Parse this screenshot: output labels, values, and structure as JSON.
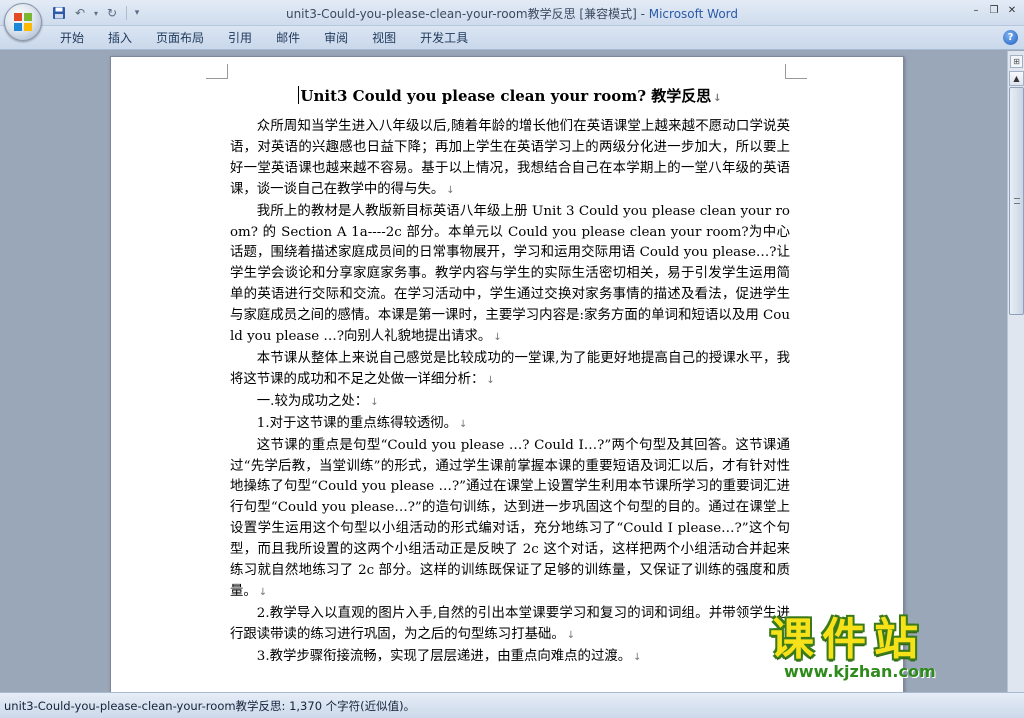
{
  "window": {
    "title": "unit3-Could-you-please-clean-your-room教学反思 [兼容模式] - ",
    "app_name": "Microsoft Word"
  },
  "qat": {
    "save_icon": "save-icon",
    "undo_icon": "undo-icon",
    "redo_icon": "redo-icon"
  },
  "ribbon": {
    "tabs": [
      "开始",
      "插入",
      "页面布局",
      "引用",
      "邮件",
      "审阅",
      "视图",
      "开发工具"
    ],
    "help": "?"
  },
  "document": {
    "title": "Unit3 Could you please clean your room? 教学反思",
    "paragraphs": [
      {
        "text": "众所周知当学生进入八年级以后,随着年龄的增长他们在英语课堂上越来越不愿动口学说英语，对英语的兴趣感也日益下降；再加上学生在英语学习上的两级分化进一步加大，所以要上好一堂英语课也越来越不容易。基于以上情况，我想结合自己在本学期上的一堂八年级的英语课，谈一谈自己在教学中的得与失。",
        "indent": true
      },
      {
        "text": "我所上的教材是人教版新目标英语八年级上册 Unit 3 Could you please clean your room? 的 Section A 1a----2c 部分。本单元以 Could you please clean your room?为中心话题，围绕着描述家庭成员间的日常事物展开，学习和运用交际用语 Could you please…?让学生学会谈论和分享家庭家务事。教学内容与学生的实际生活密切相关，易于引发学生运用简单的英语进行交际和交流。在学习活动中，学生通过交换对家务事情的描述及看法，促进学生与家庭成员之间的感情。本课是第一课时，主要学习内容是:家务方面的单词和短语以及用 Could you please …?向别人礼貌地提出请求。",
        "indent": true
      },
      {
        "text": "本节课从整体上来说自己感觉是比较成功的一堂课,为了能更好地提高自己的授课水平，我将这节课的成功和不足之处做一详细分析：",
        "indent": true
      },
      {
        "text": "一.较为成功之处：",
        "indent": true
      },
      {
        "text": "1.对于这节课的重点练得较透彻。",
        "indent": true
      },
      {
        "text": "这节课的重点是句型“Could you please …? Could I…?”两个句型及其回答。这节课通过“先学后教，当堂训练”的形式，通过学生课前掌握本课的重要短语及词汇以后，才有针对性地操练了句型“Could you please …?”通过在课堂上设置学生利用本节课所学习的重要词汇进行句型“Could you please…?”的造句训练，达到进一步巩固这个句型的目的。通过在课堂上设置学生运用这个句型以小组活动的形式编对话，充分地练习了“Could I please…?”这个句型，而且我所设置的这两个小组活动正是反映了 2c 这个对话，这样把两个小组活动合并起来练习就自然地练习了 2c 部分。这样的训练既保证了足够的训练量，又保证了训练的强度和质量。",
        "indent": true
      },
      {
        "text": "2.教学导入以直观的图片入手,自然的引出本堂课要学习和复习的词和词组。并带领学生进行跟读带读的练习进行巩固，为之后的句型练习打基础。",
        "indent": true
      },
      {
        "text": "3.教学步骤衔接流畅，实现了层层递进，由重点向难点的过渡。",
        "indent": true
      }
    ]
  },
  "statusbar": {
    "text": "unit3-Could-you-please-clean-your-room教学反思: 1,370 个字符(近似值)。"
  },
  "watermark": {
    "cn": "课件站",
    "url": "www.kjzhan.com"
  },
  "colors": {
    "title_bar": "#dbe5f3",
    "app_name": "#2b5aa8",
    "workspace": "#9aa7b9",
    "watermark_yellow": "#f7e21a",
    "watermark_green": "#3a7a1a"
  }
}
